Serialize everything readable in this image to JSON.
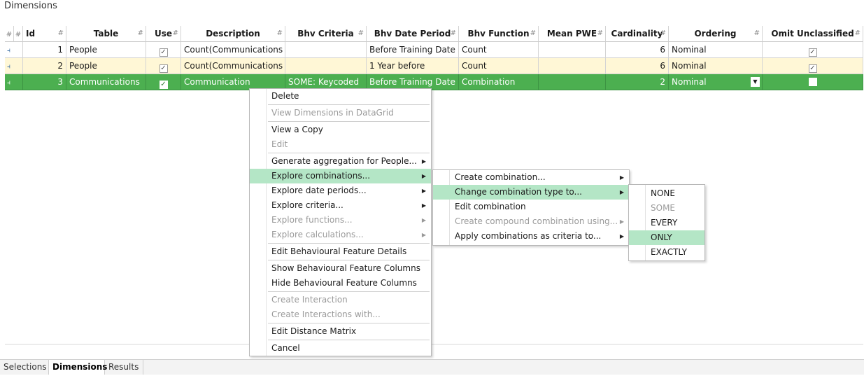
{
  "panel": {
    "title": "Dimensions"
  },
  "grid": {
    "headers": {
      "pin1": "#",
      "pin2": "#",
      "id": "Id",
      "table": "Table",
      "use": "Use",
      "description": "Description",
      "bhv_criteria": "Bhv Criteria",
      "bhv_date_period": "Bhv Date Period",
      "bhv_function": "Bhv Function",
      "mean_pwe": "Mean PWE",
      "cardinality": "Cardinality",
      "ordering": "Ordering",
      "omit_unclassified": "Omit Unclassified"
    },
    "rows": [
      {
        "id": "1",
        "table": "People",
        "use": "✓",
        "description": "Count(Communications",
        "bhv_criteria": "",
        "bhv_date_period": "Before Training Date",
        "bhv_function": "Count",
        "mean_pwe": "",
        "cardinality": "6",
        "ordering": "Nominal",
        "omit_unclassified": "✓"
      },
      {
        "id": "2",
        "table": "People",
        "use": "✓",
        "description": "Count(Communications",
        "bhv_criteria": "",
        "bhv_date_period": "1 Year before",
        "bhv_function": "Count",
        "mean_pwe": "",
        "cardinality": "6",
        "ordering": "Nominal",
        "omit_unclassified": "✓"
      },
      {
        "id": "3",
        "table": "Communications",
        "use": "✓",
        "description": "Communication",
        "bhv_criteria": "SOME: Keycoded",
        "bhv_date_period": "Before Training Date",
        "bhv_function": "Combination",
        "mean_pwe": "",
        "cardinality": "2",
        "ordering": "Nominal",
        "omit_unclassified": ""
      }
    ]
  },
  "context_menu": {
    "items": [
      {
        "label": "Delete"
      },
      {
        "label": "View Dimensions in DataGrid"
      },
      {
        "label": "View a Copy"
      },
      {
        "label": "Edit"
      },
      {
        "label": "Generate aggregation for People..."
      },
      {
        "label": "Explore combinations..."
      },
      {
        "label": "Explore date periods..."
      },
      {
        "label": "Explore criteria..."
      },
      {
        "label": "Explore functions..."
      },
      {
        "label": "Explore calculations..."
      },
      {
        "label": "Edit Behavioural Feature Details"
      },
      {
        "label": "Show Behavioural Feature Columns"
      },
      {
        "label": "Hide Behavioural Feature Columns"
      },
      {
        "label": "Create Interaction"
      },
      {
        "label": "Create Interactions with..."
      },
      {
        "label": "Edit Distance Matrix"
      },
      {
        "label": "Cancel"
      }
    ]
  },
  "combinations_menu": {
    "items": [
      {
        "label": "Create combination..."
      },
      {
        "label": "Change combination type to..."
      },
      {
        "label": "Edit combination"
      },
      {
        "label": "Create compound combination using..."
      },
      {
        "label": "Apply combinations as criteria to..."
      }
    ]
  },
  "type_menu": {
    "items": [
      {
        "label": "NONE"
      },
      {
        "label": "SOME"
      },
      {
        "label": "EVERY"
      },
      {
        "label": "ONLY"
      },
      {
        "label": "EXACTLY"
      }
    ]
  },
  "tabs": [
    {
      "label": "Selections"
    },
    {
      "label": "Dimensions"
    },
    {
      "label": "Results"
    }
  ],
  "colors": {
    "selected_row": "#4caf50",
    "alt_row": "#fff7d6",
    "menu_highlight": "#b4e6c6"
  }
}
